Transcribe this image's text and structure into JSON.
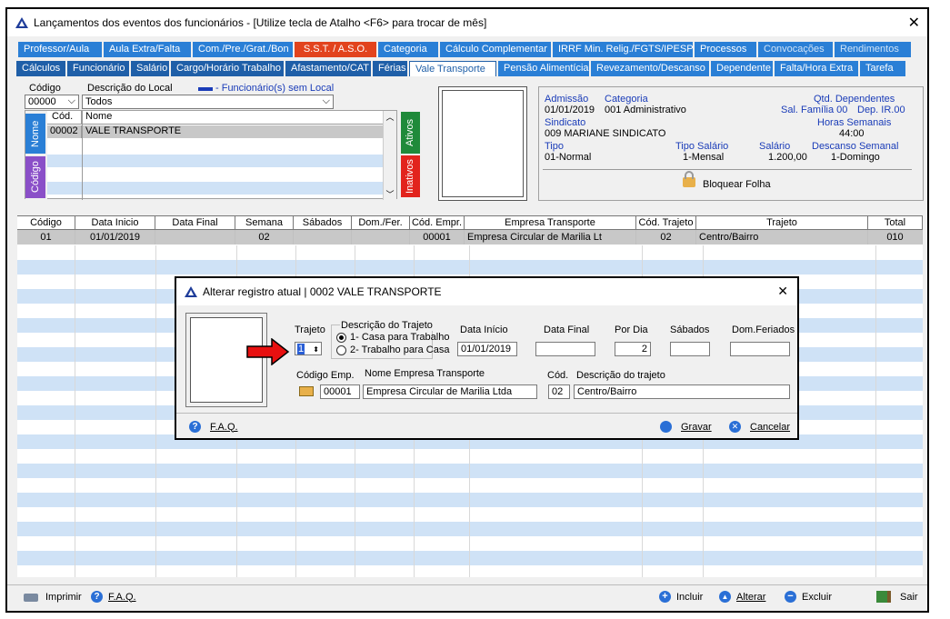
{
  "window": {
    "title": "Lançamentos dos eventos dos funcionários - [Utilize tecla de Atalho <F6> para trocar de mês]",
    "close": "✕"
  },
  "tabs_row1": [
    "Professor/Aula",
    "Aula Extra/Falta",
    "Com./Pre./Grat./Bon",
    "S.S.T. / A.S.O.",
    "Categoria",
    "Cálculo Complementar",
    "IRRF Min. Relig./FGTS/IPESP",
    "Processos",
    "Convocações",
    "Rendimentos"
  ],
  "tabs_row2": [
    "Cálculos",
    "Funcionário",
    "Salário",
    "Cargo/Horário Trabalho",
    "Afastamento/CAT",
    "Férias",
    "Vale Transporte",
    "Pensão Alimentícia",
    "Revezamento/Descanso",
    "Dependente",
    "Falta/Hora Extra",
    "Tarefa"
  ],
  "filter": {
    "codigo_label": "Código",
    "codigo_value": "00000",
    "desc_label": "Descrição do Local",
    "desc_value": "Todos",
    "legend": "- Funcionário(s) sem Local",
    "col_cod": "Cód.",
    "col_nome": "Nome",
    "row_cod": "00002",
    "row_nome": "VALE TRANSPORTE",
    "side_nome": "Nome",
    "side_codigo": "Código",
    "ativos": "Ativos",
    "inativos": "Inativos"
  },
  "info": {
    "admissao_label": "Admissão",
    "admissao": "01/01/2019",
    "categoria_label": "Categoria",
    "categoria": "001  Administrativo",
    "qtd_label": "Qtd. Dependentes",
    "salfam": "Sal. Família 00",
    "depir": "Dep. IR.00",
    "sindicato_label": "Sindicato",
    "sindicato": "009  MARIANE SINDICATO",
    "horas_label": "Horas Semanais",
    "horas": "44:00",
    "tipo_label": "Tipo",
    "tipo": "01-Normal",
    "tiposal_label": "Tipo Salário",
    "tiposal": "1-Mensal",
    "salario_label": "Salário",
    "salario": "1.200,00",
    "descanso_label": "Descanso Semanal",
    "descanso": "1-Domingo",
    "bloquear": "Bloquear Folha"
  },
  "grid": {
    "headers": [
      "Código",
      "Data Inicio",
      "Data Final",
      "Semana",
      "Sábados",
      "Dom./Fer.",
      "Cód. Empr.",
      "Empresa Transporte",
      "Cód. Trajeto",
      "Trajeto",
      "Total"
    ],
    "row": [
      "01",
      "01/01/2019",
      "",
      "02",
      "",
      "",
      "00001",
      "Empresa Circular de Marilia Lt",
      "02",
      "Centro/Bairro",
      "010"
    ]
  },
  "dialog": {
    "title": "Alterar registro atual | 0002 VALE TRANSPORTE",
    "close": "✕",
    "trajeto_label": "Trajeto",
    "trajeto_value": "1",
    "desc_trajeto_label": "Descrição do Trajeto",
    "radio1": "1- Casa para Trabalho",
    "radio2": "2- Trabalho para Casa",
    "data_inicio_label": "Data Início",
    "data_inicio": "01/01/2019",
    "data_final_label": "Data Final",
    "data_final": "",
    "por_dia_label": "Por Dia",
    "por_dia": "2",
    "sabados_label": "Sábados",
    "sabados": "",
    "dom_label": "Dom.Feriados",
    "dom": "",
    "cod_emp_label": "Código Emp.",
    "cod_emp": "00001",
    "nome_emp_label": "Nome Empresa Transporte",
    "nome_emp": "Empresa Circular de Marilia Ltda",
    "cod_label": "Cód.",
    "cod": "02",
    "desc_traj_label": "Descrição do trajeto",
    "desc_traj": "Centro/Bairro",
    "faq": "F.A.Q.",
    "gravar": "Gravar",
    "cancelar": "Cancelar"
  },
  "footer": {
    "imprimir": "Imprimir",
    "faq": "F.A.Q.",
    "incluir": "Incluir",
    "alterar": "Alterar",
    "excluir": "Excluir",
    "sair": "Sair"
  }
}
